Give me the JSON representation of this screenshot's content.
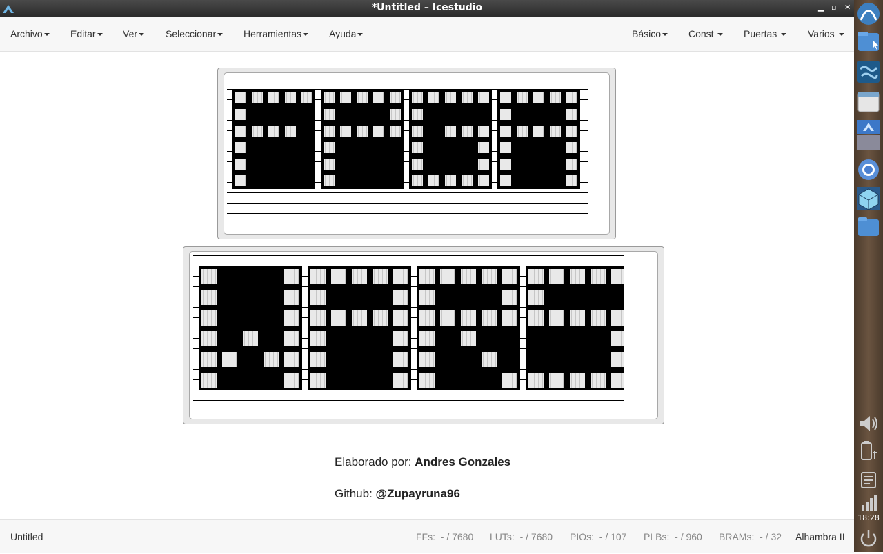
{
  "window": {
    "title": "*Untitled – Icestudio"
  },
  "menubar": {
    "left": [
      "Archivo",
      "Editar",
      "Ver",
      "Seleccionar",
      "Herramientas",
      "Ayuda"
    ],
    "right": [
      "Básico",
      "Const",
      "Puertas",
      "Varios"
    ]
  },
  "canvas": {
    "image1_text": "FPGA",
    "image2_text": "WARS",
    "credit_label": "Elaborado por:",
    "credit_name": "Andres Gonzales",
    "github_label": "Github:",
    "github_handle": "@Zupayruna96"
  },
  "footer": {
    "project_name": "Untitled",
    "stats": [
      {
        "label": "FFs:",
        "value": "- / 7680"
      },
      {
        "label": "LUTs:",
        "value": "- / 7680"
      },
      {
        "label": "PIOs:",
        "value": "- / 107"
      },
      {
        "label": "PLBs:",
        "value": "- / 960"
      },
      {
        "label": "BRAMs:",
        "value": "- / 32"
      }
    ],
    "board": "Alhambra II"
  },
  "launcher": {
    "clock": "18:28",
    "icons": [
      "ubuntu-logo-icon",
      "file-manager-icon",
      "world-map-icon",
      "window-icon",
      "icestudio-icon",
      "chromium-icon",
      "cube-icon",
      "folder-icon",
      "volume-icon",
      "battery-icon",
      "notes-icon",
      "signal-icon",
      "power-icon"
    ]
  }
}
